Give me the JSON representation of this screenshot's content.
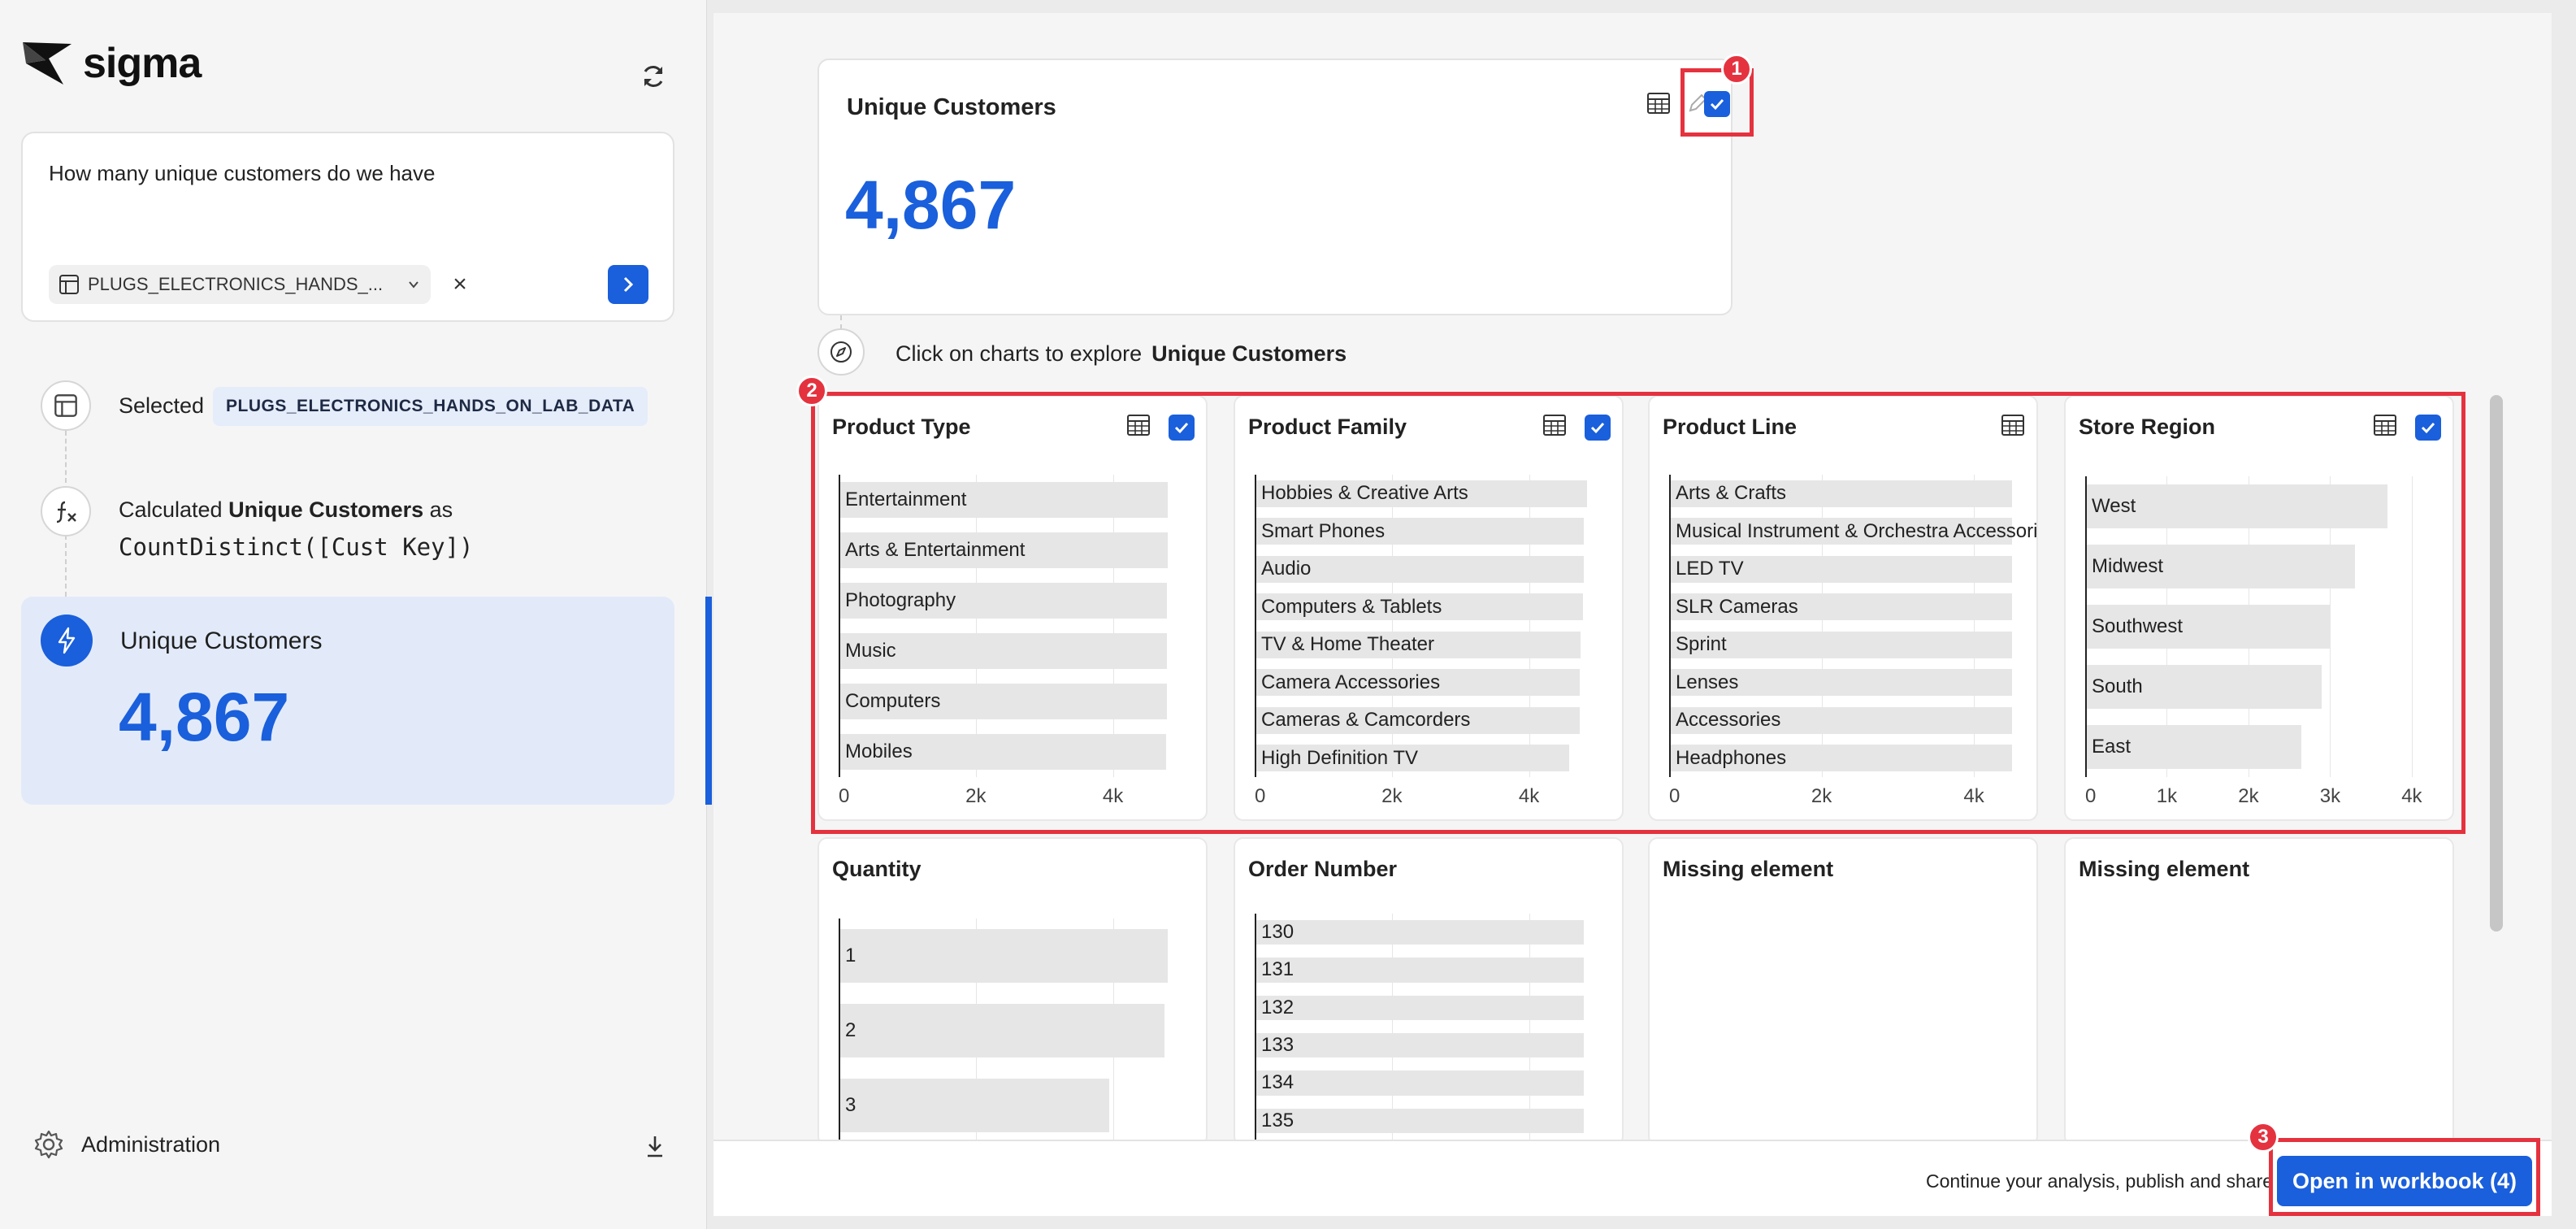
{
  "app": {
    "name": "sigma"
  },
  "query": {
    "text": "How many unique customers do we have",
    "source": "PLUGS_ELECTRONICS_HANDS_...",
    "clear_icon": "×"
  },
  "steps": [
    {
      "icon": "table-icon",
      "label": "Selected",
      "value": "PLUGS_ELECTRONICS_HANDS_ON_LAB_DATA"
    },
    {
      "icon": "function-icon",
      "prefix": "Calculated",
      "name": "Unique Customers",
      "suffix": "as",
      "formula": "CountDistinct([Cust Key])"
    }
  ],
  "answer": {
    "title": "Unique Customers",
    "value": "4,867"
  },
  "admin": {
    "label": "Administration"
  },
  "kpi": {
    "title": "Unique Customers",
    "value": "4,867",
    "checked": true
  },
  "explore": {
    "text": "Click on charts to explore",
    "target": "Unique Customers"
  },
  "callouts": [
    "1",
    "2",
    "3"
  ],
  "charts": [
    {
      "title": "Product Type",
      "checked": true,
      "max": 5000,
      "ticks": [
        "0",
        "2k",
        "4k"
      ],
      "tick_values": [
        0,
        2000,
        4000
      ],
      "bars": [
        {
          "label": "Entertainment",
          "value": 4800
        },
        {
          "label": "Arts & Entertainment",
          "value": 4800
        },
        {
          "label": "Photography",
          "value": 4790
        },
        {
          "label": "Music",
          "value": 4790
        },
        {
          "label": "Computers",
          "value": 4790
        },
        {
          "label": "Mobiles",
          "value": 4780
        }
      ]
    },
    {
      "title": "Product Family",
      "checked": true,
      "max": 5000,
      "ticks": [
        "0",
        "2k",
        "4k"
      ],
      "tick_values": [
        0,
        2000,
        4000
      ],
      "bars": [
        {
          "label": "Hobbies & Creative Arts",
          "value": 4850
        },
        {
          "label": "Smart Phones",
          "value": 4800
        },
        {
          "label": "Audio",
          "value": 4800
        },
        {
          "label": "Computers & Tablets",
          "value": 4790
        },
        {
          "label": "TV & Home Theater",
          "value": 4750
        },
        {
          "label": "Camera Accessories",
          "value": 4740
        },
        {
          "label": "Cameras & Camcorders",
          "value": 4740
        },
        {
          "label": "High Definition TV",
          "value": 4590
        }
      ]
    },
    {
      "title": "Product Line",
      "checked": false,
      "max": 4500,
      "ticks": [
        "0",
        "2k",
        "4k"
      ],
      "tick_values": [
        0,
        2000,
        4000
      ],
      "bars": [
        {
          "label": "Arts & Crafts",
          "value": 4700
        },
        {
          "label": "Musical Instrument & Orchestra Accessories",
          "value": 4650
        },
        {
          "label": "LED TV",
          "value": 4600
        },
        {
          "label": "SLR Cameras",
          "value": 4580
        },
        {
          "label": "Sprint",
          "value": 4570
        },
        {
          "label": "Lenses",
          "value": 4560
        },
        {
          "label": "Accessories",
          "value": 4550
        },
        {
          "label": "Headphones",
          "value": 4550
        }
      ]
    },
    {
      "title": "Store Region",
      "checked": true,
      "max": 4200,
      "ticks": [
        "0",
        "1k",
        "2k",
        "3k",
        "4k"
      ],
      "tick_values": [
        0,
        1000,
        2000,
        3000,
        4000
      ],
      "bars": [
        {
          "label": "West",
          "value": 3700
        },
        {
          "label": "Midwest",
          "value": 3300
        },
        {
          "label": "Southwest",
          "value": 3000
        },
        {
          "label": "South",
          "value": 2900
        },
        {
          "label": "East",
          "value": 2650
        }
      ]
    }
  ],
  "charts_row2": [
    {
      "title": "Quantity",
      "max": 5000,
      "tick_values": [
        2000,
        4000
      ],
      "bars": [
        {
          "label": "1",
          "value": 4800
        },
        {
          "label": "2",
          "value": 4750
        },
        {
          "label": "3",
          "value": 3950
        }
      ]
    },
    {
      "title": "Order Number",
      "max": 5000,
      "tick_values": [
        2000,
        4000
      ],
      "bars": [
        {
          "label": "130",
          "value": 4800
        },
        {
          "label": "131",
          "value": 4800
        },
        {
          "label": "132",
          "value": 4800
        },
        {
          "label": "133",
          "value": 4800
        },
        {
          "label": "134",
          "value": 4800
        },
        {
          "label": "135",
          "value": 4800
        }
      ]
    },
    {
      "title": "Missing element"
    },
    {
      "title": "Missing element"
    }
  ],
  "footer": {
    "text": "Continue your analysis, publish and share",
    "button": "Open in workbook (4)"
  },
  "colors": {
    "accent": "#1a5fdb",
    "callout": "#e5323f",
    "bar": "#e6e6e6"
  }
}
